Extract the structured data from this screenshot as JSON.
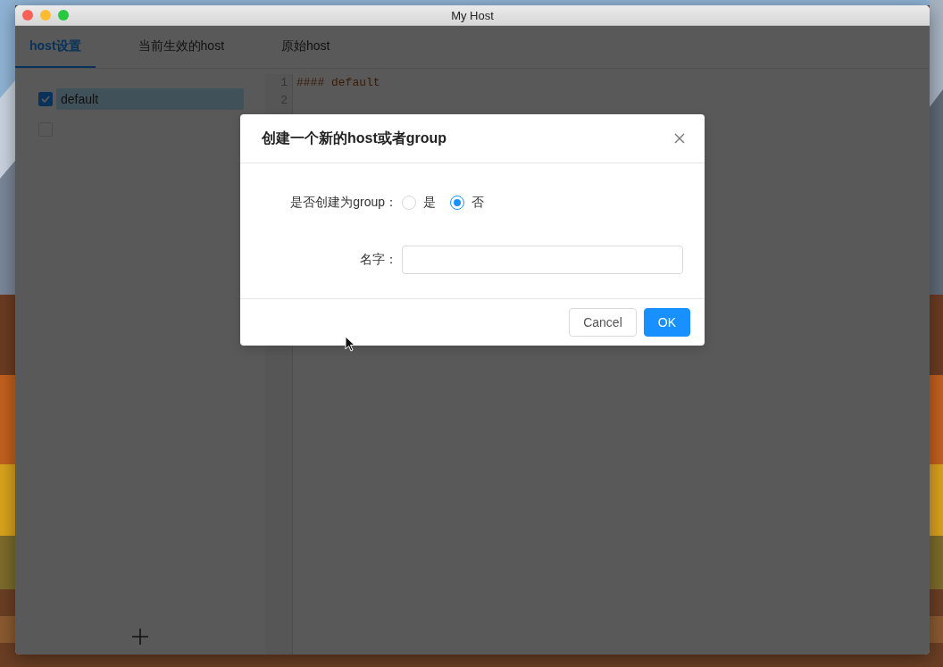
{
  "window": {
    "title": "My Host"
  },
  "tabs": [
    {
      "label": "host设置",
      "selected": true
    },
    {
      "label": "当前生效的host",
      "selected": false
    },
    {
      "label": "原始host",
      "selected": false
    }
  ],
  "sidebar": {
    "items": [
      {
        "label": "default",
        "checked": true,
        "selected": true
      },
      {
        "checked": false,
        "selected": false
      }
    ]
  },
  "editor": {
    "lines": [
      {
        "number": "1",
        "text": "#### default"
      },
      {
        "number": "2"
      }
    ]
  },
  "dialog": {
    "title": "创建一个新的host或者group",
    "fields": [
      {
        "kind": "radio",
        "label": "是否创建为group：",
        "options": [
          {
            "label": "是",
            "selected": false
          },
          {
            "label": "否",
            "selected": true
          }
        ]
      },
      {
        "kind": "text",
        "label": "名字："
      }
    ],
    "buttons": [
      {
        "label": "Cancel",
        "kind": "default"
      },
      {
        "label": "OK",
        "kind": "primary"
      }
    ]
  }
}
